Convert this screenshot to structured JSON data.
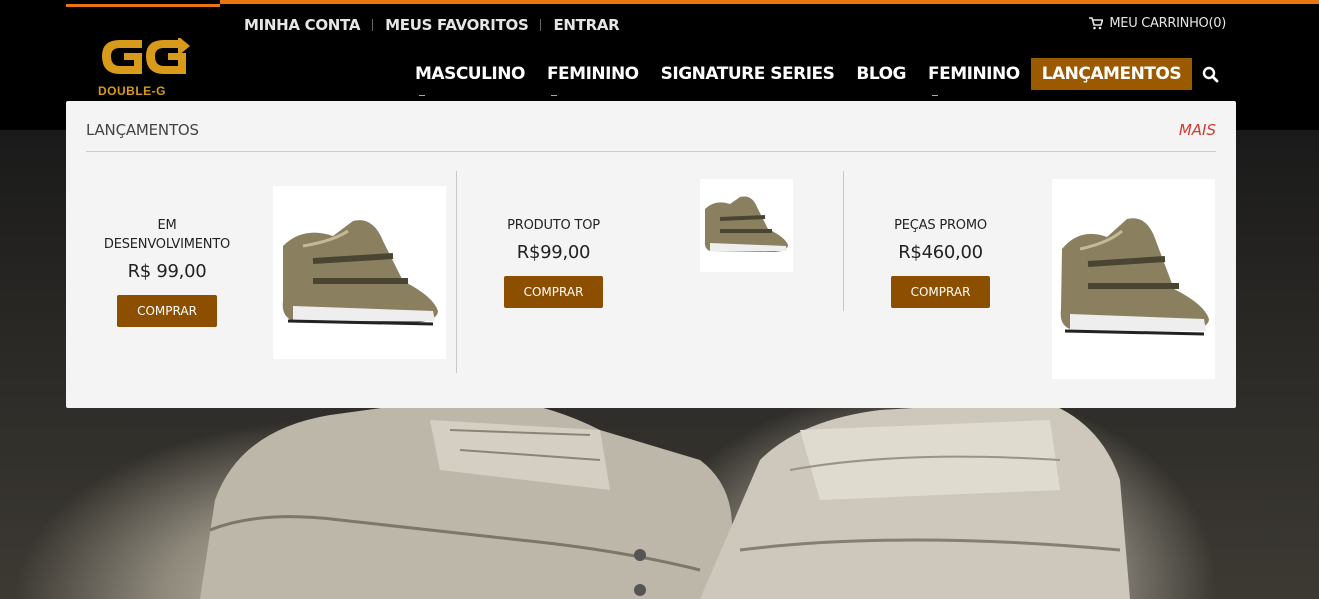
{
  "colors": {
    "accent_orange": "#e87511",
    "active_nav_bg": "#9b5a00",
    "buy_button": "#8c4f00",
    "more_link": "#d03a2f",
    "logo_gold": "#d89a1a"
  },
  "brand": {
    "logo_text": "DOUBLE-G",
    "logo_icon": "double-g-logo"
  },
  "account_nav": [
    {
      "label": "MINHA CONTA"
    },
    {
      "label": "MEUS FAVORITOS"
    },
    {
      "label": "ENTRAR"
    }
  ],
  "cart": {
    "icon": "cart-icon",
    "label": "MEU CARRINHO(0)"
  },
  "main_nav": [
    {
      "label": "MASCULINO",
      "has_submenu": true
    },
    {
      "label": "FEMININO",
      "has_submenu": true
    },
    {
      "label": "SIGNATURE SERIES",
      "has_submenu": false
    },
    {
      "label": "BLOG",
      "has_submenu": false
    },
    {
      "label": "FEMININO",
      "has_submenu": true
    },
    {
      "label": "LANÇAMENTOS",
      "has_submenu": false,
      "active": true
    }
  ],
  "search": {
    "icon": "search-icon"
  },
  "dropdown": {
    "title": "LANÇAMENTOS",
    "more_label": "MAIS",
    "products": [
      {
        "name_line1": "EM",
        "name_line2": "DESENVOLVIMENTO",
        "price": "R$ 99,00",
        "button": "COMPRAR",
        "image": "gold-sneaker"
      },
      {
        "name_line1": "PRODUTO TOP",
        "name_line2": "",
        "price": "R$99,00",
        "button": "COMPRAR",
        "image": "gold-sneaker-small"
      },
      {
        "name_line1": "PEÇAS PROMO",
        "name_line2": "",
        "price": "R$460,00",
        "button": "COMPRAR",
        "image": "gold-sneaker"
      }
    ]
  },
  "hero": {
    "image": "white-sneakers-hero"
  }
}
